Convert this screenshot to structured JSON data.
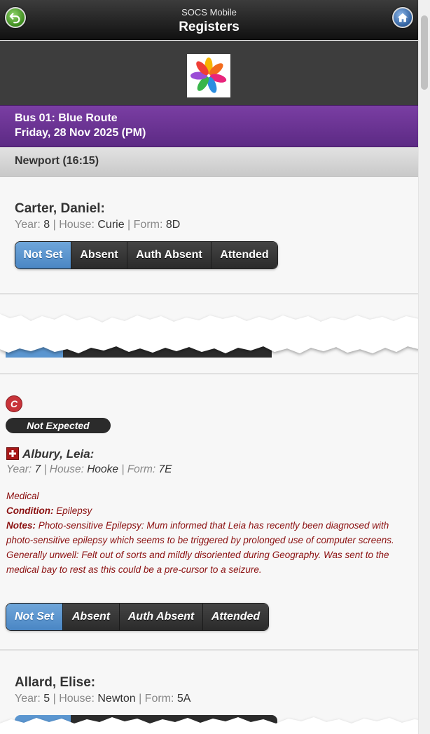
{
  "header": {
    "app_name": "SOCS Mobile",
    "title": "Registers",
    "back_icon": "back-arrow-icon",
    "home_icon": "home-icon"
  },
  "route": {
    "line1": "Bus 01: Blue Route",
    "line2": "Friday, 28 Nov 2025 (PM)"
  },
  "stop": {
    "label": "Newport (16:15)"
  },
  "labels": {
    "year": "Year:",
    "house": "House:",
    "form": "Form:",
    "sep": "|"
  },
  "attendance_options": [
    "Not Set",
    "Absent",
    "Auth Absent",
    "Attended"
  ],
  "students": [
    {
      "name": "Carter, Daniel:",
      "year": "8",
      "house": "Curie",
      "form": "8D",
      "selected": "Not Set"
    },
    {
      "name": "Albury, Leia:",
      "year": "7",
      "house": "Hooke",
      "form": "7E",
      "selected": "Not Set",
      "badge_letter": "C",
      "status": "Not Expected",
      "medical": {
        "heading": "Medical",
        "condition_label": "Condition:",
        "condition": "Epilepsy",
        "notes_label": "Notes:",
        "notes": "Photo-sensitive Epilepsy: Mum informed that Leia has recently been diagnosed with photo-sensitive epilepsy which seems to be triggered by prolonged use of computer screens. Generally unwell: Felt out of sorts and mildly disoriented during Geography. Was sent to the medical bay to rest as this could be a pre-cursor to a seizure."
      }
    },
    {
      "name": "Allard, Elise:",
      "year": "5",
      "house": "Newton",
      "form": "5A"
    }
  ],
  "colors": {
    "header_bg": "#1f1f1f",
    "route_bar": "#6a3394",
    "selected_button": "#5b96d0",
    "medical_text": "#8b1010",
    "expected_badge": "#c8343a"
  }
}
